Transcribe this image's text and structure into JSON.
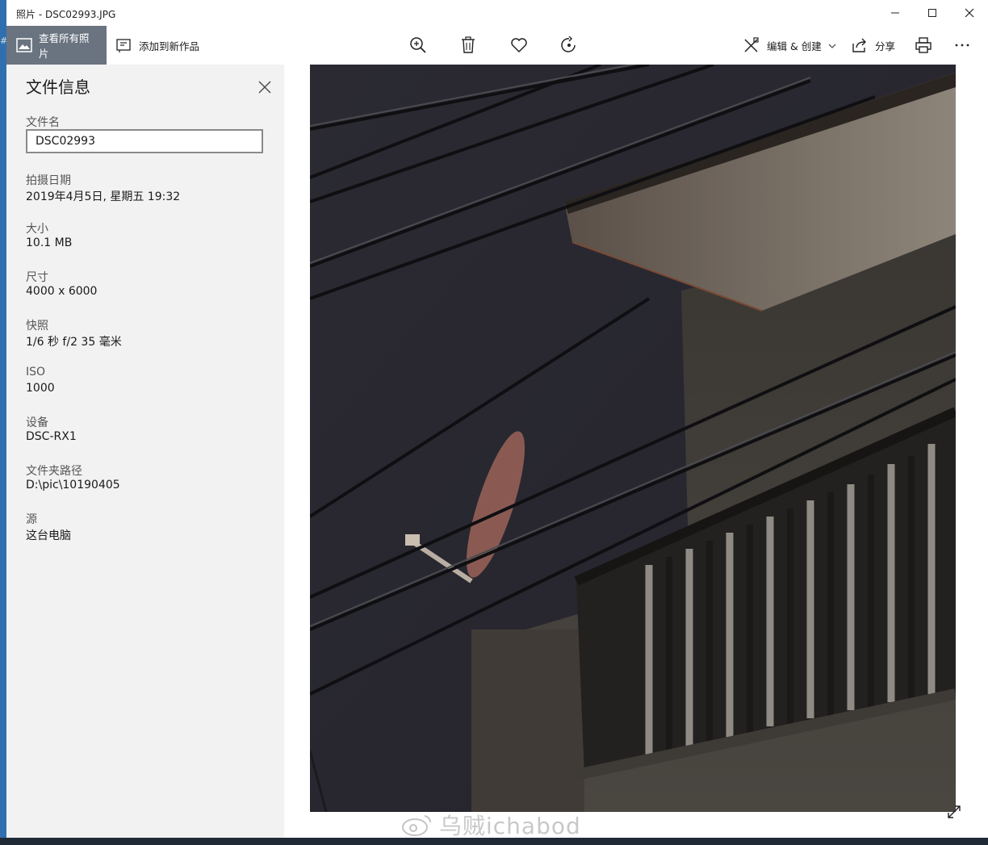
{
  "window": {
    "title": "照片 - DSC02993.JPG",
    "controls": {
      "minimize": "minimize-icon",
      "maximize": "maximize-icon",
      "close": "close-icon"
    }
  },
  "toolbar": {
    "view_all_label": "查看所有照片",
    "add_to_creation_label": "添加到新作品",
    "edit_create_label": "编辑 & 创建",
    "share_label": "分享",
    "icons": [
      "zoom-in-icon",
      "delete-icon",
      "favorite-icon",
      "rotate-icon",
      "print-icon",
      "more-icon"
    ]
  },
  "panel": {
    "title": "文件信息",
    "filename_label": "文件名",
    "filename_value": "DSC02993",
    "fields": [
      {
        "label": "拍摄日期",
        "value": "2019年4月5日, 星期五 19:32"
      },
      {
        "label": "大小",
        "value": "10.1 MB"
      },
      {
        "label": "尺寸",
        "value": "4000 x 6000"
      },
      {
        "label": "快照",
        "value": "1/6 秒 f/2 35 毫米"
      },
      {
        "label": "ISO",
        "value": "1000"
      },
      {
        "label": "设备",
        "value": "DSC-RX1"
      },
      {
        "label": "文件夹路径",
        "value": "D:\\pic\\10190405"
      },
      {
        "label": "源",
        "value": "这台电脑"
      }
    ]
  },
  "watermark": {
    "text": "乌贼ichabod"
  },
  "colors": {
    "primary_button": "#6a7480",
    "panel_bg": "#f2f2f2",
    "accent": "#2f6fb0"
  }
}
